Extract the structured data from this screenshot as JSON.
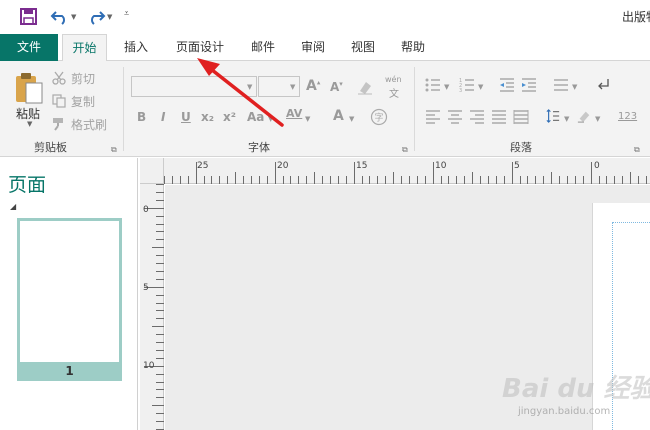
{
  "window": {
    "title": "出版物"
  },
  "qat": {
    "icons": [
      "save-icon",
      "undo-icon",
      "redo-icon",
      "customize-icon"
    ]
  },
  "tabs": [
    {
      "label": "文件"
    },
    {
      "label": "开始"
    },
    {
      "label": "插入"
    },
    {
      "label": "页面设计"
    },
    {
      "label": "邮件"
    },
    {
      "label": "审阅"
    },
    {
      "label": "视图"
    },
    {
      "label": "帮助"
    }
  ],
  "ribbon": {
    "clipboard": {
      "label": "剪贴板",
      "paste": "粘贴",
      "cut": "剪切",
      "copy": "复制",
      "format_painter": "格式刷"
    },
    "font": {
      "label": "字体",
      "buttons": [
        "B",
        "I",
        "U",
        "x₂",
        "x²",
        "Aa",
        "AV",
        "A"
      ],
      "wen_top": "wén",
      "wen_bottom": "文"
    },
    "paragraph": {
      "label": "段落",
      "number_format": "123"
    }
  },
  "pages_panel": {
    "title": "页面",
    "pages": [
      {
        "number": "1"
      }
    ]
  },
  "ruler": {
    "horizontal": [
      "25",
      "20",
      "15",
      "10",
      "5",
      "0"
    ],
    "vertical": [
      "0",
      "5",
      "10"
    ]
  },
  "watermark": {
    "text": "Bai du 经验",
    "url": "jingyan.baidu.com"
  },
  "colors": {
    "accent": "#077568",
    "thumb": "#9dcdc6",
    "arrow": "#e02020"
  }
}
